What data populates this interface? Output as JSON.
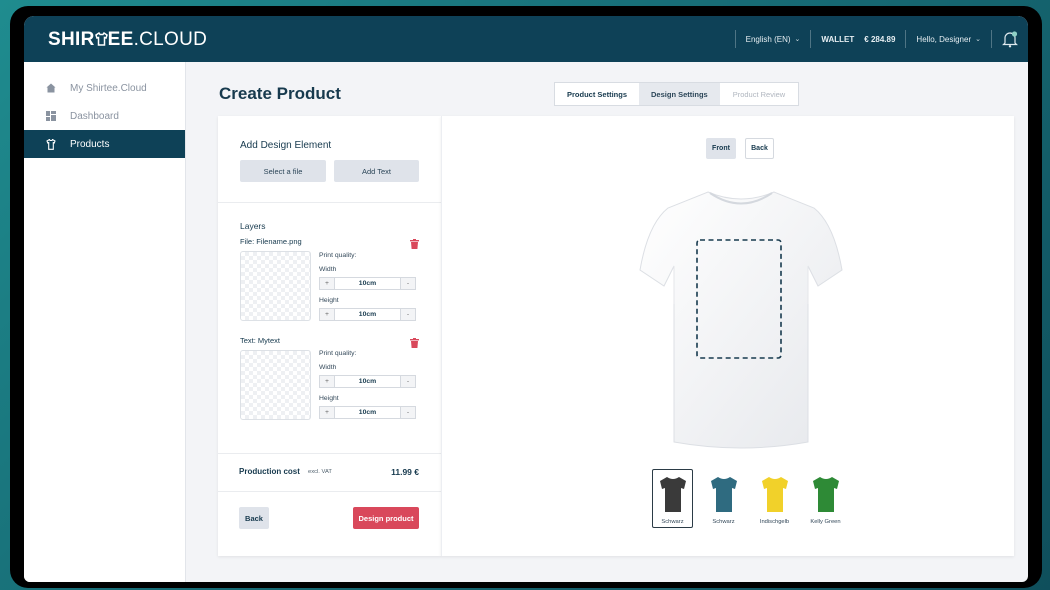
{
  "brand": {
    "logo_bold": "SHIR",
    "logo_bold2": "EE",
    "logo_thin": ".CLOUD"
  },
  "header": {
    "language": "English (EN)",
    "wallet_label": "WALLET",
    "wallet_amount": "€ 284.89",
    "greeting": "Hello, Designer"
  },
  "sidebar": {
    "items": [
      {
        "label": "My Shirtee.Cloud",
        "icon": "home-icon"
      },
      {
        "label": "Dashboard",
        "icon": "dashboard-icon"
      },
      {
        "label": "Products",
        "icon": "shirt-icon",
        "active": true
      }
    ]
  },
  "page": {
    "title": "Create Product"
  },
  "tabs": {
    "product_settings": "Product Settings",
    "design_settings": "Design Settings",
    "product_review": "Product Review"
  },
  "design_element": {
    "title": "Add Design Element",
    "select_file": "Select a file",
    "add_text": "Add Text"
  },
  "layers": {
    "title": "Layers",
    "items": [
      {
        "name": "File:  Filename.png",
        "print_quality": "Print quality:",
        "width_label": "Width",
        "width_value": "10cm",
        "height_label": "Height",
        "height_value": "10cm"
      },
      {
        "name": "Text:  Mytext",
        "print_quality": "Print quality:",
        "width_label": "Width",
        "width_value": "10cm",
        "height_label": "Height",
        "height_value": "10cm"
      }
    ],
    "plus": "+",
    "minus": "-"
  },
  "cost": {
    "label": "Production cost",
    "vat": "excl. VAT",
    "value": "11.99 €"
  },
  "actions": {
    "back": "Back",
    "design_product": "Design product"
  },
  "view": {
    "front": "Front",
    "back": "Back"
  },
  "swatches": [
    {
      "label": "Schwarz",
      "color": "#3a3a3a",
      "selected": true
    },
    {
      "label": "Schwarz",
      "color": "#2f6b80"
    },
    {
      "label": "Indischgelb",
      "color": "#f1d12a"
    },
    {
      "label": "Kelly Green",
      "color": "#2e8a36"
    }
  ],
  "colors": {
    "primary": "#0e4157",
    "accent": "#d9485b"
  }
}
